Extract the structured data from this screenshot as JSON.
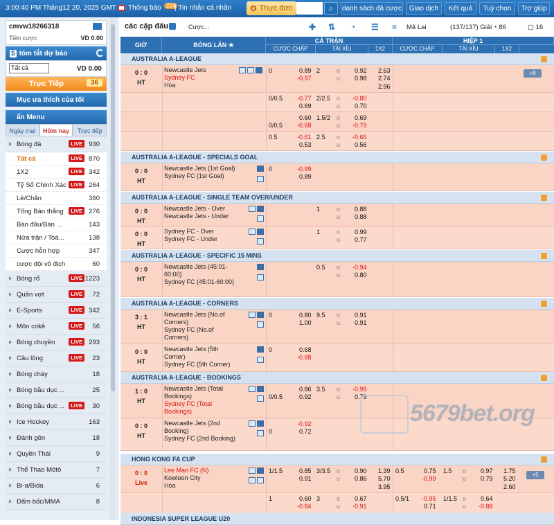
{
  "topbar": {
    "time": "3:00:40 PM Tháng12 20, 2025 GMT +8",
    "notice": "Thông báo",
    "notice_count": "224",
    "messages": "Tin nhắn cá nhân",
    "menu": "Thực đơn",
    "buttons": [
      "danh sách đã cược",
      "Giao dịch",
      "Kết quả",
      "Tuỳ chọn",
      "Trợ giúp"
    ]
  },
  "account": {
    "username": "cmvw18266318",
    "balance_label": "Tiền cược",
    "balance": "VD 0.00"
  },
  "bet_summary": {
    "title": "tóm tắt dự báo",
    "select": "Tất cả",
    "value": "VD 0.00"
  },
  "live": {
    "label": "Trực Tiếp",
    "count": "36"
  },
  "favorites": {
    "label": "Mục ưa thích của tôi"
  },
  "menu": {
    "title": "ẩn Menu",
    "tabs": [
      "Ngày mai",
      "Hôm nay",
      "Trực tiếp"
    ]
  },
  "sports": [
    {
      "name": "Bóng đá",
      "live": "LIVE",
      "count": "930",
      "type": "main"
    },
    {
      "name": "Tất cả",
      "live": "LIVE",
      "count": "870",
      "type": "sub",
      "hi": true
    },
    {
      "name": "1X2",
      "live": "LIVE",
      "count": "342",
      "type": "sub"
    },
    {
      "name": "Tỷ Số Chính Xác",
      "live": "LIVE",
      "count": "264",
      "type": "sub"
    },
    {
      "name": "Lẻ/Chẵn",
      "live": "",
      "count": "360",
      "type": "sub"
    },
    {
      "name": "Tổng Bàn thắng",
      "live": "LIVE",
      "count": "276",
      "type": "sub"
    },
    {
      "name": "Bàn đầu/Bàn ...",
      "live": "",
      "count": "143",
      "type": "sub"
    },
    {
      "name": "Nửa trận / Toà...",
      "live": "",
      "count": "138",
      "type": "sub"
    },
    {
      "name": "Cược hỗn hợp",
      "live": "",
      "count": "347",
      "type": "sub"
    },
    {
      "name": "cược đội vô địch",
      "live": "",
      "count": "60",
      "type": "sub"
    },
    {
      "name": "Bóng rổ",
      "live": "LIVE",
      "count": "1223",
      "type": "main"
    },
    {
      "name": "Quần vợt",
      "live": "LIVE",
      "count": "72",
      "type": "main"
    },
    {
      "name": "E-Sports",
      "live": "LIVE",
      "count": "342",
      "type": "main"
    },
    {
      "name": "Môn crikê",
      "live": "LIVE",
      "count": "56",
      "type": "main"
    },
    {
      "name": "Bóng chuyền",
      "live": "LIVE",
      "count": "293",
      "type": "main"
    },
    {
      "name": "Cầu lông",
      "live": "LIVE",
      "count": "23",
      "type": "main"
    },
    {
      "name": "Bóng chày",
      "live": "",
      "count": "18",
      "type": "main"
    },
    {
      "name": "Bóng bầu dục ...",
      "live": "",
      "count": "25",
      "type": "main"
    },
    {
      "name": "Bóng bầu dục ...",
      "live": "LIVE",
      "count": "30",
      "type": "main"
    },
    {
      "name": "Ice Hockey",
      "live": "",
      "count": "163",
      "type": "main"
    },
    {
      "name": "Đánh gôn",
      "live": "",
      "count": "18",
      "type": "main"
    },
    {
      "name": "Quyền Thái",
      "live": "",
      "count": "9",
      "type": "main"
    },
    {
      "name": "Thể Thao Môtô",
      "live": "",
      "count": "7",
      "type": "main"
    },
    {
      "name": "Bi-a/Bida",
      "live": "",
      "count": "6",
      "type": "main"
    },
    {
      "name": "Đấm bốc/MMA",
      "live": "",
      "count": "8",
      "type": "main"
    }
  ],
  "toolbar": {
    "title": "các cặp đấu",
    "sort": "Cược...",
    "odds_type": "Mã Lai",
    "games": "(137/137) Giải",
    "fav_count": "86",
    "count2": "16"
  },
  "table_head": {
    "time": "GIỜ",
    "event": "BÓNG LĂN",
    "full": "CẢ TRẬN",
    "half": "HIỆP 1",
    "hdp": "CƯỢC CHẤP",
    "ou": "TÀI XỈU",
    "x12": "1X2"
  },
  "leagues": [
    {
      "name": "AUSTRALIA A-LEAGUE"
    },
    {
      "name": "AUSTRALIA A-LEAGUE - SPECIALS GOAL"
    },
    {
      "name": "AUSTRALIA A-LEAGUE - SINGLE TEAM OVER/UNDER"
    },
    {
      "name": "AUSTRALIA A-LEAGUE - SPECIFIC 15 MINS"
    },
    {
      "name": "AUSTRALIA A-LEAGUE - CORNERS"
    },
    {
      "name": "AUSTRALIA A-LEAGUE - BOOKINGS"
    },
    {
      "name": "HONG KONG FA CUP"
    }
  ],
  "matches": {
    "m1": {
      "score": "0 : 0",
      "time": "HT",
      "home": "Newcastle Jets",
      "away": "Sydney FC",
      "draw": "Hòa",
      "more": "+8",
      "rows": [
        {
          "h": "0",
          "hv": "0.89",
          "av": "-0.97",
          "ou": "2",
          "ov": "0.92",
          "uv": "0.98",
          "x1": "2.63",
          "x2": "2.74",
          "xd": "2.96"
        },
        {
          "h": "0/0.5",
          "hv": "-0.77",
          "av": "0.69",
          "ou": "2/2.5",
          "ov": "-0.80",
          "uv": "0.70"
        },
        {
          "h": "",
          "hv": "0.60",
          "av": "-0.68",
          "h2": "0/0.5",
          "ou": "1.5/2",
          "ov": "0.69",
          "uv": "-0.79"
        },
        {
          "h": "0.5",
          "hv": "-0.61",
          "av": "0.53",
          "ou": "2.5",
          "ov": "-0.66",
          "uv": "0.56"
        }
      ]
    },
    "m2": {
      "score": "0 : 0",
      "time": "HT",
      "home": "Newcastle Jets (1st Goal)",
      "away": "Sydney FC (1st Goal)",
      "h": "0",
      "hv": "-0.99",
      "av": "0.89"
    },
    "m3": {
      "score": "0 : 0",
      "time": "HT",
      "home": "Newcastle Jets - Over",
      "away": "Newcastle Jets - Under",
      "ou": "1",
      "ov": "0.88",
      "uv": "0.88"
    },
    "m4": {
      "score": "0 : 0",
      "time": "HT",
      "home": "Sydney FC - Over",
      "away": "Sydney FC - Under",
      "ou": "1",
      "ov": "0.99",
      "uv": "0.77"
    },
    "m5": {
      "score": "0 : 0",
      "time": "HT",
      "home": "Newcastle Jets (45:01-60:00)",
      "away": "Sydney FC (45:01-60:00)",
      "ou": "0.5",
      "ov": "-0.94",
      "uv": "0.80"
    },
    "m6": {
      "score": "3 : 1",
      "time": "HT",
      "home": "Newcastle Jets (No.of Corners)",
      "away": "Sydney FC (No.of Corners)",
      "h": "0",
      "hv": "0.80",
      "av": "1.00",
      "ou": "9.5",
      "ov": "0.91",
      "uv": "0.91"
    },
    "m7": {
      "score": "0 : 0",
      "time": "HT",
      "home": "Newcastle Jets (5th Corner)",
      "away": "Sydney FC (5th Corner)",
      "h": "0",
      "hv": "0.68",
      "av": "-0.88"
    },
    "m8": {
      "score": "1 : 0",
      "time": "HT",
      "home": "Newcastle Jets (Total Bookings)",
      "away": "Sydney FC (Total Bookings)",
      "h2": "0/0.5",
      "hv": "0.86",
      "av": "0.92",
      "ou": "3.5",
      "ov": "-0.99",
      "uv": "0.79"
    },
    "m9": {
      "score": "0 : 0",
      "time": "HT",
      "home": "Newcastle Jets (2nd Booking)",
      "away": "Sydney FC (2nd Booking)",
      "h2": "0",
      "hv": "-0.92",
      "av": "0.72"
    },
    "m10": {
      "score": "0 : 0",
      "time": "Live",
      "home": "Lee Man FC (N)",
      "away": "Kowloon City",
      "draw": "Hòa",
      "more": "+5",
      "r1": {
        "h": "1/1.5",
        "hv": "0.85",
        "av": "0.91",
        "ou": "3/3.5",
        "ov": "0.90",
        "uv": "0.86",
        "x1": "1.39",
        "x2": "5.70",
        "xd": "3.95",
        "hh": "0.5",
        "hhv": "0.75",
        "hav": "-0.99",
        "hou": "1.5",
        "hov": "0.97",
        "huv": "0.79",
        "hx1": "1.75",
        "hx2": "5.20",
        "hxd": "2.60"
      },
      "r2": {
        "h": "1",
        "hv": "0.60",
        "av": "-0.84",
        "ou": "3",
        "ov": "0.67",
        "uv": "-0.91",
        "hh": "0.5/1",
        "hhv": "-0.95",
        "hav": "0.71",
        "hou": "1/1.5",
        "hov": "0.64",
        "huv": "-0.88"
      }
    }
  },
  "next_league": "INDONESIA SUPER LEAGUE U20",
  "watermark": "5679bet.org",
  "colors": {
    "header_blue": "#2c6fb2",
    "row_pink": "#fad4c5",
    "live_red": "#d4191b",
    "accent_orange": "#f28a1c"
  }
}
